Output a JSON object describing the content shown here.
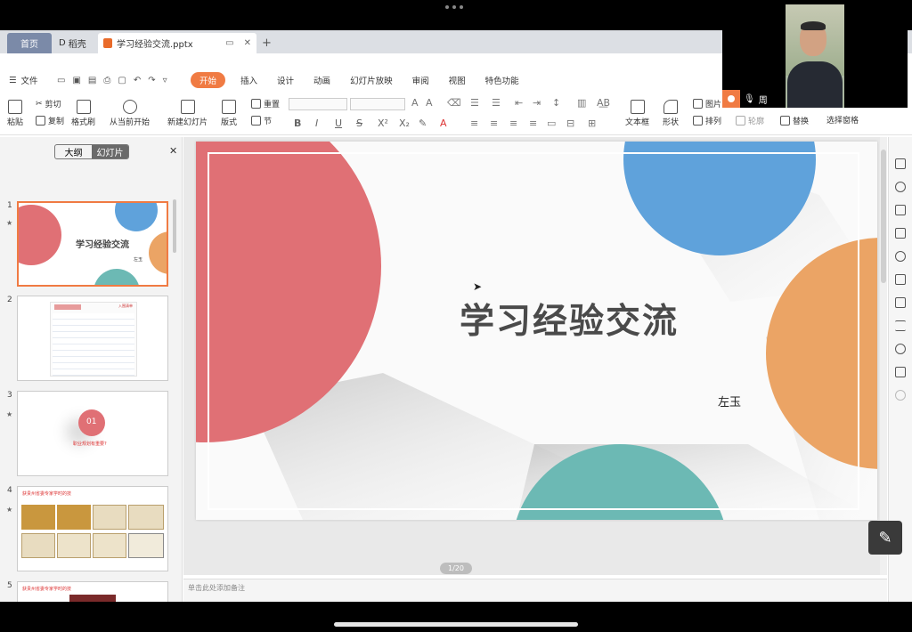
{
  "tabs": {
    "home": "首页",
    "draft": "稻壳",
    "doc": "学习经验交流.pptx",
    "add": "+"
  },
  "menu": {
    "file": "文件",
    "items": [
      "开始",
      "插入",
      "设计",
      "动画",
      "幻灯片放映",
      "审阅",
      "视图",
      "特色功能"
    ]
  },
  "ribbon": {
    "paste": "粘贴",
    "cut": "剪切",
    "copy": "复制",
    "format_painter": "格式刷",
    "from_current": "从当前开始",
    "new_slide": "新建幻灯片",
    "layout": "版式",
    "reset": "重置",
    "section": "节",
    "textbox": "文本框",
    "shape": "形状",
    "picture": "图片",
    "arrange": "排列",
    "outline": "轮廓",
    "replace": "替换",
    "select_pane": "选择窗格"
  },
  "panel": {
    "outline_tab": "大纲",
    "slides_tab": "幻灯片",
    "thumbs": [
      {
        "num": "1",
        "title": "学习经验交流",
        "sub": "左玉"
      },
      {
        "num": "2",
        "title": "入围清单"
      },
      {
        "num": "3",
        "badge": "01",
        "caption": "职业规划有重要?"
      },
      {
        "num": "4",
        "caption": "获贵州省委专家学时的技"
      },
      {
        "num": "5",
        "caption": "获贵州省委专家学时的技"
      }
    ],
    "add": "+"
  },
  "slide": {
    "title": "学习经验交流",
    "author": "左玉",
    "page": "1/20",
    "colors": {
      "red": "#e07075",
      "blue": "#5fa2db",
      "orange": "#eba465",
      "teal": "#6cb9b4"
    }
  },
  "notes": "单击此处添加备注",
  "video": {
    "user_name": "周"
  }
}
